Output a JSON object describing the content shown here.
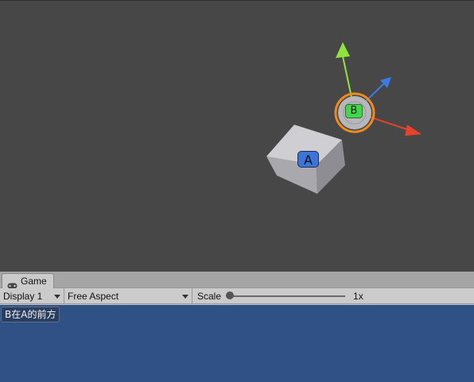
{
  "scene": {
    "object_a_label": "A",
    "object_b_label": "B",
    "colors": {
      "background": "#474747",
      "cube": "#b9b9bd",
      "label_a": "#3d74d8",
      "label_b": "#46d64c",
      "gizmo_y": "#8fe33d",
      "gizmo_z": "#3b7be8",
      "gizmo_x": "#e8432a",
      "selection_outline": "#f08a1c"
    }
  },
  "game_panel": {
    "tab_label": "Game",
    "tab_icon": "gamepad-icon",
    "toolbar": {
      "display_value": "Display 1",
      "aspect_value": "Free Aspect",
      "scale_label": "Scale",
      "scale_value": "1x"
    },
    "overlay_text": "B在A的前方",
    "colors": {
      "game_view_bg": "#2f5186"
    }
  }
}
